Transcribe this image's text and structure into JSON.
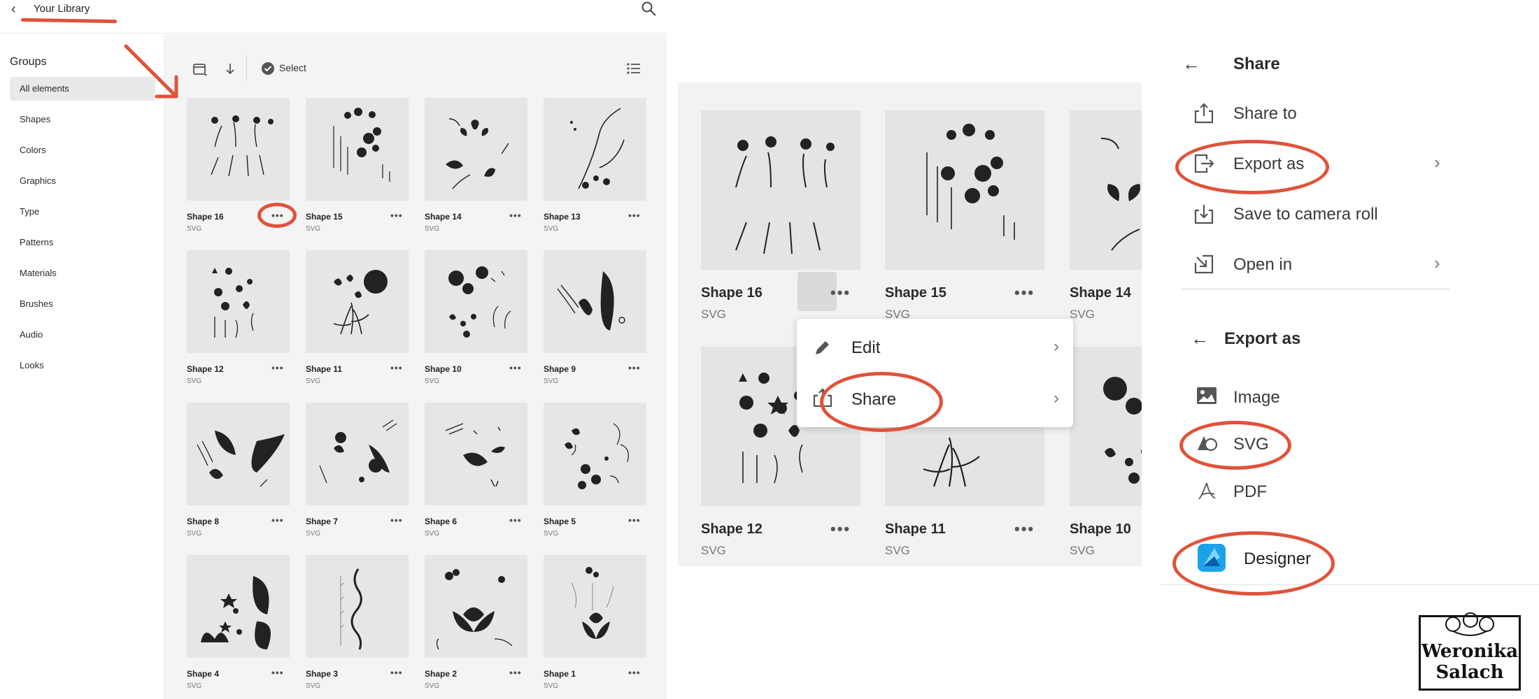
{
  "library": {
    "title": "Your Library",
    "back_icon": "chevron-left-icon",
    "search_icon": "search-icon",
    "groups_heading": "Groups",
    "groups": [
      {
        "label": "All elements",
        "active": true
      },
      {
        "label": "Shapes"
      },
      {
        "label": "Colors"
      },
      {
        "label": "Graphics"
      },
      {
        "label": "Type"
      },
      {
        "label": "Patterns"
      },
      {
        "label": "Materials"
      },
      {
        "label": "Brushes"
      },
      {
        "label": "Audio"
      },
      {
        "label": "Looks"
      }
    ],
    "toolbar": {
      "select_label": "Select",
      "icons": [
        "calendar-sort-icon",
        "sort-down-icon",
        "check-circle-icon",
        "list-view-icon"
      ]
    },
    "tiles": [
      {
        "name": "Shape 16",
        "type": "SVG"
      },
      {
        "name": "Shape 15",
        "type": "SVG"
      },
      {
        "name": "Shape 14",
        "type": "SVG"
      },
      {
        "name": "Shape 13",
        "type": "SVG"
      },
      {
        "name": "Shape 12",
        "type": "SVG"
      },
      {
        "name": "Shape 11",
        "type": "SVG"
      },
      {
        "name": "Shape 10",
        "type": "SVG"
      },
      {
        "name": "Shape 9",
        "type": "SVG"
      },
      {
        "name": "Shape 8",
        "type": "SVG"
      },
      {
        "name": "Shape 7",
        "type": "SVG"
      },
      {
        "name": "Shape 6",
        "type": "SVG"
      },
      {
        "name": "Shape 5",
        "type": "SVG"
      },
      {
        "name": "Shape 4",
        "type": "SVG"
      },
      {
        "name": "Shape 3",
        "type": "SVG"
      },
      {
        "name": "Shape 2",
        "type": "SVG"
      },
      {
        "name": "Shape 1",
        "type": "SVG"
      }
    ],
    "more_label": "•••"
  },
  "zoom": {
    "tiles": [
      {
        "name": "Shape 16",
        "type": "SVG"
      },
      {
        "name": "Shape 15",
        "type": "SVG"
      },
      {
        "name": "Shape 14",
        "type": "SVG"
      },
      {
        "name": "Shape 12",
        "type": "SVG"
      },
      {
        "name": "Shape 11",
        "type": "SVG"
      },
      {
        "name": "Shape 10",
        "type": "SVG"
      }
    ],
    "menu": {
      "edit_label": "Edit",
      "share_label": "Share",
      "edit_icon": "pencil-icon",
      "share_icon": "share-icon",
      "chevron": "›"
    }
  },
  "share": {
    "title": "Share",
    "items": [
      {
        "label": "Share to",
        "icon": "share-out-icon"
      },
      {
        "label": "Export as",
        "icon": "export-icon"
      },
      {
        "label": "Save to camera roll",
        "icon": "download-icon"
      },
      {
        "label": "Open in",
        "icon": "open-in-icon"
      }
    ],
    "export_title": "Export as",
    "export_items": [
      {
        "label": "Image",
        "icon": "image-icon"
      },
      {
        "label": "SVG",
        "icon": "svg-shapes-icon"
      },
      {
        "label": "PDF",
        "icon": "pdf-icon"
      },
      {
        "label": "Designer",
        "icon": "affinity-designer-icon"
      }
    ],
    "back_arrow": "←",
    "chevron": "›"
  },
  "logo": {
    "line1": "Weronika",
    "line2": "Salach"
  },
  "colors": {
    "annotation": "#e0523a",
    "grid_bg": "#f4f4f4",
    "tile_bg": "#e6e6e6",
    "sidebar_active": "#e9e9e9",
    "designer_blue": "#1aa3e8"
  }
}
